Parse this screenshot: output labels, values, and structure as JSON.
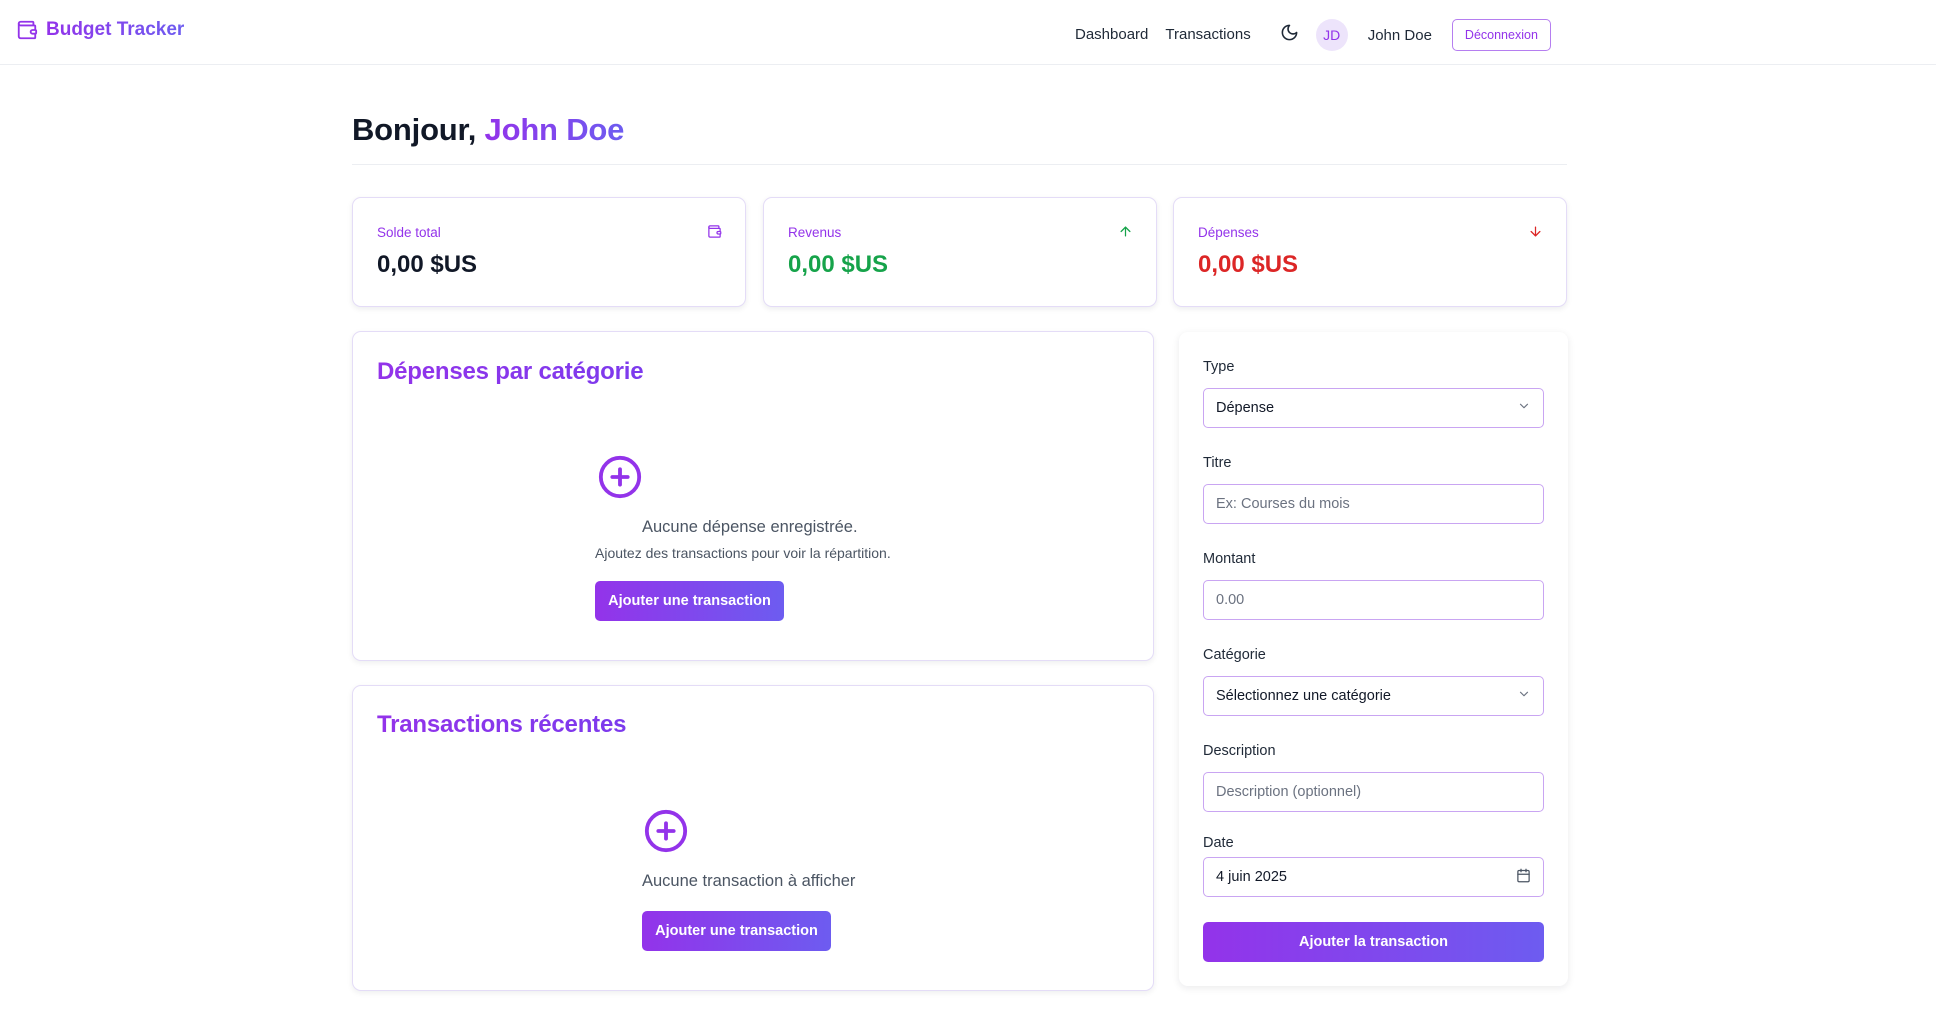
{
  "app": {
    "title": "Budget Tracker"
  },
  "nav": {
    "links": [
      "Dashboard",
      "Transactions"
    ],
    "avatar_initials": "JD",
    "user_name": "John Doe",
    "logout_label": "Déconnexion"
  },
  "greeting": {
    "prefix": "Bonjour,",
    "name": "John Doe"
  },
  "stats": {
    "balance": {
      "label": "Solde total",
      "value": "0,00 $US",
      "color": "#111827"
    },
    "income": {
      "label": "Revenus",
      "value": "0,00 $US",
      "color": "#16a34a"
    },
    "expenses": {
      "label": "Dépenses",
      "value": "0,00 $US",
      "color": "#dc2626"
    }
  },
  "expenses_by_category": {
    "title": "Dépenses par catégorie",
    "empty_title": "Aucune dépense enregistrée.",
    "empty_subtitle": "Ajoutez des transactions pour voir la répartition.",
    "button_label": "Ajouter une transaction"
  },
  "recent_transactions": {
    "title": "Transactions récentes",
    "empty_title": "Aucune transaction à afficher",
    "button_label": "Ajouter une transaction"
  },
  "form": {
    "type": {
      "label": "Type",
      "value": "Dépense"
    },
    "title": {
      "label": "Titre",
      "placeholder": "Ex: Courses du mois"
    },
    "amount": {
      "label": "Montant",
      "placeholder": "0.00"
    },
    "category": {
      "label": "Catégorie",
      "value": "Sélectionnez une catégorie"
    },
    "description": {
      "label": "Description",
      "placeholder": "Description (optionnel)"
    },
    "date": {
      "label": "Date",
      "value": "4 juin 2025"
    },
    "submit_label": "Ajouter la transaction"
  },
  "colors": {
    "accent": "#9333ea",
    "accent_end": "#6d5cf0",
    "income": "#16a34a",
    "expense": "#dc2626"
  },
  "icons": {
    "logo": "wallet-icon",
    "theme": "moon-icon",
    "balance": "wallet-icon",
    "income": "arrow-up-icon",
    "expenses": "arrow-down-icon",
    "empty": "plus-circle-icon",
    "select": "chevron-down-icon",
    "date": "calendar-icon"
  }
}
